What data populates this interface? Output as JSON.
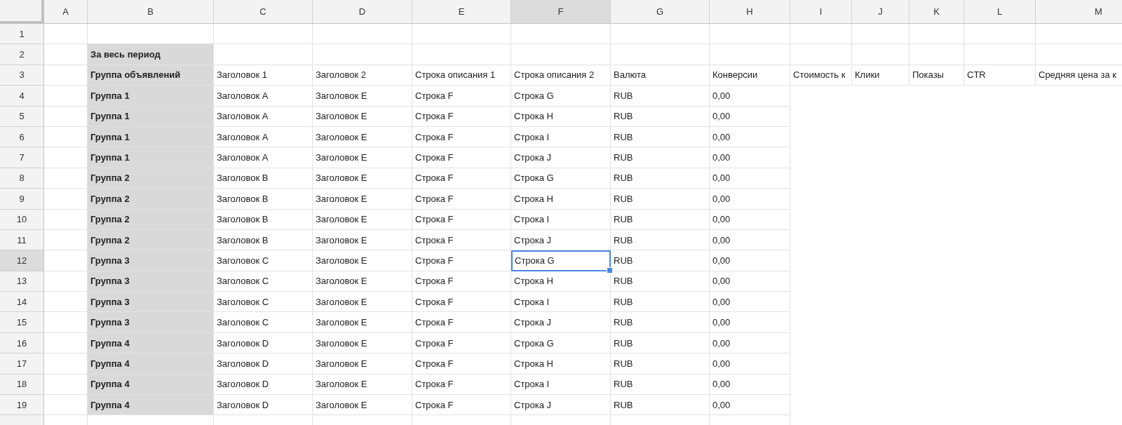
{
  "columns": [
    {
      "label": "A",
      "selected": false
    },
    {
      "label": "B",
      "selected": false
    },
    {
      "label": "C",
      "selected": false
    },
    {
      "label": "D",
      "selected": false
    },
    {
      "label": "E",
      "selected": false
    },
    {
      "label": "F",
      "selected": true
    },
    {
      "label": "G",
      "selected": false
    },
    {
      "label": "H",
      "selected": false
    },
    {
      "label": "I",
      "selected": false
    },
    {
      "label": "J",
      "selected": false
    },
    {
      "label": "K",
      "selected": false
    },
    {
      "label": "L",
      "selected": false
    },
    {
      "label": "M",
      "selected": false
    }
  ],
  "rows": [
    {
      "number": "1",
      "selected": false,
      "kind": "full"
    },
    {
      "number": "2",
      "selected": false,
      "kind": "full",
      "cells": [
        {
          "text": "За весь период",
          "selected": false
        }
      ]
    },
    {
      "number": "3",
      "selected": false,
      "kind": "full",
      "cells": [
        {
          "text": "Группа объявлений",
          "selected": false
        },
        {
          "text": "Заголовок 1",
          "selected": false
        },
        {
          "text": "Заголовок 2",
          "selected": false
        },
        {
          "text": "Строка описания 1",
          "selected": false
        },
        {
          "text": "Строка описания 2",
          "selected": false
        },
        {
          "text": "Валюта",
          "selected": false
        },
        {
          "text": "Конверсии",
          "selected": false
        },
        {
          "text": "Стоимость к",
          "selected": false
        },
        {
          "text": "Клики",
          "selected": false
        },
        {
          "text": "Показы",
          "selected": false
        },
        {
          "text": "CTR",
          "selected": false
        },
        {
          "text": "Средняя цена за к",
          "selected": false
        }
      ]
    },
    {
      "number": "4",
      "selected": false,
      "kind": "short",
      "cells": [
        {
          "text": "Группа 1",
          "selected": false
        },
        {
          "text": "Заголовок A",
          "selected": false
        },
        {
          "text": "Заголовок E",
          "selected": false
        },
        {
          "text": "Строка F",
          "selected": false
        },
        {
          "text": "Строка G",
          "selected": false
        },
        {
          "text": "RUB",
          "selected": false
        },
        {
          "text": "0,00",
          "selected": false
        }
      ]
    },
    {
      "number": "5",
      "selected": false,
      "kind": "short",
      "cells": [
        {
          "text": "Группа 1",
          "selected": false
        },
        {
          "text": "Заголовок A",
          "selected": false
        },
        {
          "text": "Заголовок E",
          "selected": false
        },
        {
          "text": "Строка F",
          "selected": false
        },
        {
          "text": "Строка H",
          "selected": false
        },
        {
          "text": "RUB",
          "selected": false
        },
        {
          "text": "0,00",
          "selected": false
        }
      ]
    },
    {
      "number": "6",
      "selected": false,
      "kind": "short",
      "cells": [
        {
          "text": "Группа 1",
          "selected": false
        },
        {
          "text": "Заголовок A",
          "selected": false
        },
        {
          "text": "Заголовок E",
          "selected": false
        },
        {
          "text": "Строка F",
          "selected": false
        },
        {
          "text": "Строка I",
          "selected": false
        },
        {
          "text": "RUB",
          "selected": false
        },
        {
          "text": "0,00",
          "selected": false
        }
      ]
    },
    {
      "number": "7",
      "selected": false,
      "kind": "short",
      "cells": [
        {
          "text": "Группа 1",
          "selected": false
        },
        {
          "text": "Заголовок A",
          "selected": false
        },
        {
          "text": "Заголовок E",
          "selected": false
        },
        {
          "text": "Строка F",
          "selected": false
        },
        {
          "text": "Строка J",
          "selected": false
        },
        {
          "text": "RUB",
          "selected": false
        },
        {
          "text": "0,00",
          "selected": false
        }
      ]
    },
    {
      "number": "8",
      "selected": false,
      "kind": "short",
      "cells": [
        {
          "text": "Группа 2",
          "selected": false
        },
        {
          "text": "Заголовок B",
          "selected": false
        },
        {
          "text": "Заголовок E",
          "selected": false
        },
        {
          "text": "Строка F",
          "selected": false
        },
        {
          "text": "Строка G",
          "selected": false
        },
        {
          "text": "RUB",
          "selected": false
        },
        {
          "text": "0,00",
          "selected": false
        }
      ]
    },
    {
      "number": "9",
      "selected": false,
      "kind": "short",
      "cells": [
        {
          "text": "Группа 2",
          "selected": false
        },
        {
          "text": "Заголовок B",
          "selected": false
        },
        {
          "text": "Заголовок E",
          "selected": false
        },
        {
          "text": "Строка F",
          "selected": false
        },
        {
          "text": "Строка H",
          "selected": false
        },
        {
          "text": "RUB",
          "selected": false
        },
        {
          "text": "0,00",
          "selected": false
        }
      ]
    },
    {
      "number": "10",
      "selected": false,
      "kind": "short",
      "cells": [
        {
          "text": "Группа 2",
          "selected": false
        },
        {
          "text": "Заголовок B",
          "selected": false
        },
        {
          "text": "Заголовок E",
          "selected": false
        },
        {
          "text": "Строка F",
          "selected": false
        },
        {
          "text": "Строка I",
          "selected": false
        },
        {
          "text": "RUB",
          "selected": false
        },
        {
          "text": "0,00",
          "selected": false
        }
      ]
    },
    {
      "number": "11",
      "selected": false,
      "kind": "short",
      "cells": [
        {
          "text": "Группа 2",
          "selected": false
        },
        {
          "text": "Заголовок B",
          "selected": false
        },
        {
          "text": "Заголовок E",
          "selected": false
        },
        {
          "text": "Строка F",
          "selected": false
        },
        {
          "text": "Строка J",
          "selected": false
        },
        {
          "text": "RUB",
          "selected": false
        },
        {
          "text": "0,00",
          "selected": false
        }
      ]
    },
    {
      "number": "12",
      "selected": true,
      "kind": "short",
      "cells": [
        {
          "text": "Группа 3",
          "selected": false
        },
        {
          "text": "Заголовок C",
          "selected": false
        },
        {
          "text": "Заголовок E",
          "selected": false
        },
        {
          "text": "Строка F",
          "selected": false
        },
        {
          "text": "Строка G",
          "selected": true
        },
        {
          "text": "RUB",
          "selected": false
        },
        {
          "text": "0,00",
          "selected": false
        }
      ]
    },
    {
      "number": "13",
      "selected": false,
      "kind": "short",
      "cells": [
        {
          "text": "Группа 3",
          "selected": false
        },
        {
          "text": "Заголовок C",
          "selected": false
        },
        {
          "text": "Заголовок E",
          "selected": false
        },
        {
          "text": "Строка F",
          "selected": false
        },
        {
          "text": "Строка H",
          "selected": false
        },
        {
          "text": "RUB",
          "selected": false
        },
        {
          "text": "0,00",
          "selected": false
        }
      ]
    },
    {
      "number": "14",
      "selected": false,
      "kind": "short",
      "cells": [
        {
          "text": "Группа 3",
          "selected": false
        },
        {
          "text": "Заголовок C",
          "selected": false
        },
        {
          "text": "Заголовок E",
          "selected": false
        },
        {
          "text": "Строка F",
          "selected": false
        },
        {
          "text": "Строка I",
          "selected": false
        },
        {
          "text": "RUB",
          "selected": false
        },
        {
          "text": "0,00",
          "selected": false
        }
      ]
    },
    {
      "number": "15",
      "selected": false,
      "kind": "short",
      "cells": [
        {
          "text": "Группа 3",
          "selected": false
        },
        {
          "text": "Заголовок C",
          "selected": false
        },
        {
          "text": "Заголовок E",
          "selected": false
        },
        {
          "text": "Строка F",
          "selected": false
        },
        {
          "text": "Строка J",
          "selected": false
        },
        {
          "text": "RUB",
          "selected": false
        },
        {
          "text": "0,00",
          "selected": false
        }
      ]
    },
    {
      "number": "16",
      "selected": false,
      "kind": "short",
      "cells": [
        {
          "text": "Группа 4",
          "selected": false
        },
        {
          "text": "Заголовок D",
          "selected": false
        },
        {
          "text": "Заголовок E",
          "selected": false
        },
        {
          "text": "Строка F",
          "selected": false
        },
        {
          "text": "Строка G",
          "selected": false
        },
        {
          "text": "RUB",
          "selected": false
        },
        {
          "text": "0,00",
          "selected": false
        }
      ]
    },
    {
      "number": "17",
      "selected": false,
      "kind": "short",
      "cells": [
        {
          "text": "Группа 4",
          "selected": false
        },
        {
          "text": "Заголовок D",
          "selected": false
        },
        {
          "text": "Заголовок E",
          "selected": false
        },
        {
          "text": "Строка F",
          "selected": false
        },
        {
          "text": "Строка H",
          "selected": false
        },
        {
          "text": "RUB",
          "selected": false
        },
        {
          "text": "0,00",
          "selected": false
        }
      ]
    },
    {
      "number": "18",
      "selected": false,
      "kind": "short",
      "cells": [
        {
          "text": "Группа 4",
          "selected": false
        },
        {
          "text": "Заголовок D",
          "selected": false
        },
        {
          "text": "Заголовок E",
          "selected": false
        },
        {
          "text": "Строка F",
          "selected": false
        },
        {
          "text": "Строка I",
          "selected": false
        },
        {
          "text": "RUB",
          "selected": false
        },
        {
          "text": "0,00",
          "selected": false
        }
      ]
    },
    {
      "number": "19",
      "selected": false,
      "kind": "short",
      "cells": [
        {
          "text": "Группа 4",
          "selected": false
        },
        {
          "text": "Заголовок D",
          "selected": false
        },
        {
          "text": "Заголовок E",
          "selected": false
        },
        {
          "text": "Строка F",
          "selected": false
        },
        {
          "text": "Строка J",
          "selected": false
        },
        {
          "text": "RUB",
          "selected": false
        },
        {
          "text": "0,00",
          "selected": false
        }
      ]
    },
    {
      "selected": false,
      "kind": "short"
    }
  ]
}
